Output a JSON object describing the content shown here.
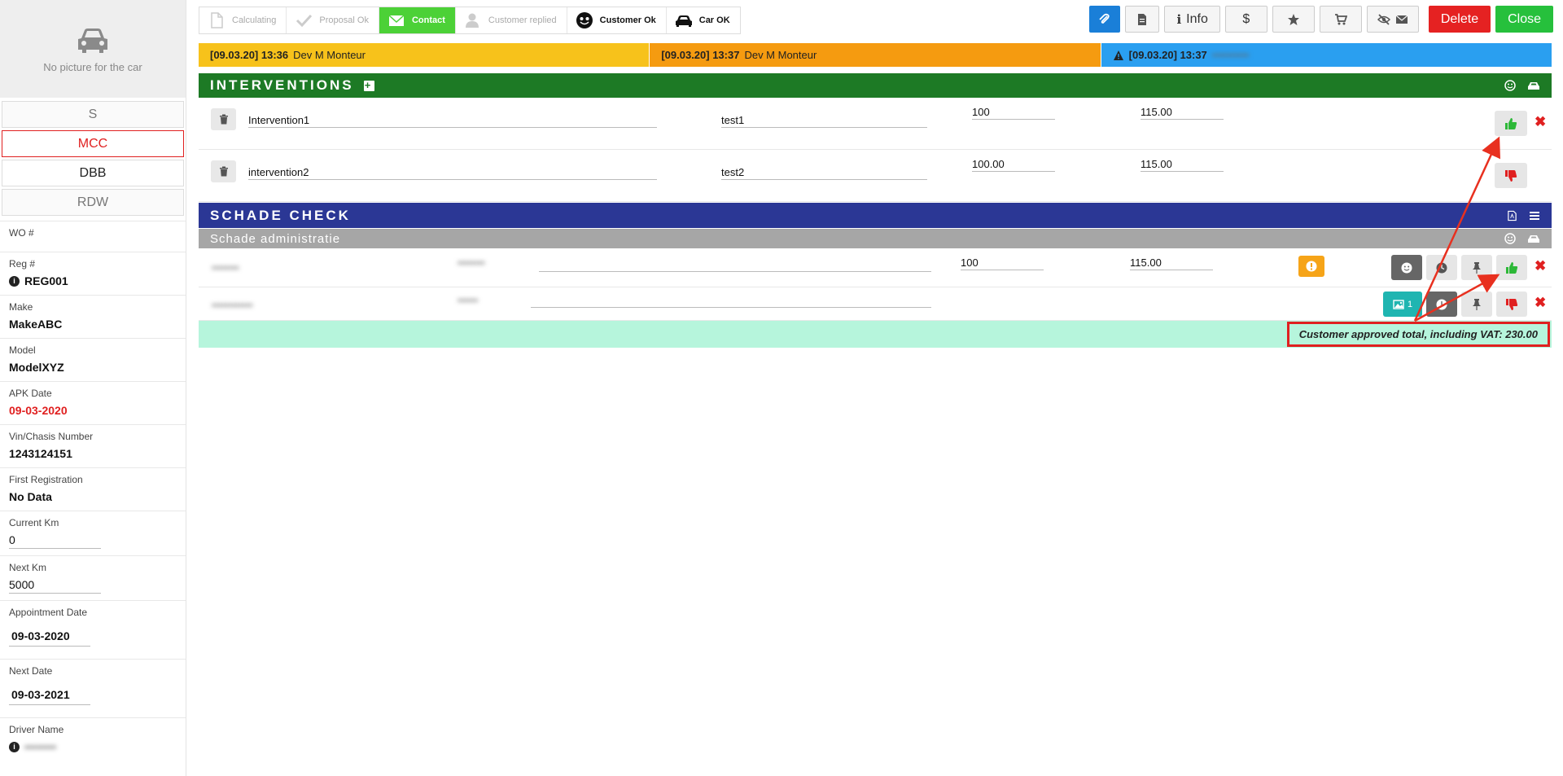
{
  "sidebar": {
    "no_picture": "No picture for the car",
    "tabs": [
      "S",
      "MCC",
      "DBB",
      "RDW"
    ],
    "fields": {
      "wo": {
        "label": "WO #",
        "value": ""
      },
      "reg": {
        "label": "Reg #",
        "value": "REG001"
      },
      "make": {
        "label": "Make",
        "value": "MakeABC"
      },
      "model": {
        "label": "Model",
        "value": "ModelXYZ"
      },
      "apk": {
        "label": "APK Date",
        "value": "09-03-2020"
      },
      "vin": {
        "label": "Vin/Chasis Number",
        "value": "1243124151"
      },
      "first_reg": {
        "label": "First Registration",
        "value": "No Data"
      },
      "current_km": {
        "label": "Current Km",
        "value": "0"
      },
      "next_km": {
        "label": "Next Km",
        "value": "5000"
      },
      "appointment": {
        "label": "Appointment Date",
        "value": "09-03-2020"
      },
      "next_date": {
        "label": "Next Date",
        "value": "09-03-2021"
      },
      "driver": {
        "label": "Driver Name",
        "value": "••••••••"
      }
    }
  },
  "steps": [
    {
      "label": "Calculating",
      "icon": "file-icon",
      "state": "pending"
    },
    {
      "label": "Proposal Ok",
      "icon": "check-icon",
      "state": "pending"
    },
    {
      "label": "Contact",
      "icon": "envelope-icon",
      "state": "active"
    },
    {
      "label": "Customer replied",
      "icon": "user-icon",
      "state": "pending"
    },
    {
      "label": "Customer Ok",
      "icon": "smile-icon",
      "state": "done"
    },
    {
      "label": "Car OK",
      "icon": "car-icon",
      "state": "done"
    }
  ],
  "actions": {
    "attach": "paperclip-icon",
    "doc": "document-icon",
    "info": "Info",
    "price": "$",
    "star": "star-icon",
    "cart": "cart-icon",
    "visibility": "eye-slash-icon",
    "delete": "Delete",
    "close": "Close"
  },
  "logs": [
    {
      "time": "[09.03.20] 13:36",
      "user": "Dev M Monteur",
      "color": "#f7c21b"
    },
    {
      "time": "[09.03.20] 13:37",
      "user": "Dev M Monteur",
      "color": "#f59b10"
    },
    {
      "time": "[09.03.20] 13:37",
      "user": "••••••••••",
      "color": "#2a9ff0"
    }
  ],
  "interventions": {
    "title": "INTERVENTIONS",
    "rows": [
      {
        "name": "Intervention1",
        "desc": "test1",
        "price": "100",
        "total": "115.00",
        "status": "approved"
      },
      {
        "name": "intervention2",
        "desc": "test2",
        "price": "100.00",
        "total": "115.00",
        "status": "rejected"
      }
    ]
  },
  "schade_check": {
    "title": "SCHADE CHECK",
    "subtitle": "Schade administratie",
    "rows": [
      {
        "name": "••••••••",
        "desc": "••••••••",
        "price": "100",
        "total": "115.00",
        "status": "approved"
      },
      {
        "name": "••••••••••••",
        "desc": "••••••",
        "price": "",
        "total": "",
        "status": "rejected",
        "photo_count": "1"
      }
    ]
  },
  "total": {
    "label": "Customer approved total, including VAT: 230.00"
  },
  "colors": {
    "interventions": "#1d7a25",
    "schade": "#2b3795",
    "approve": "#2db838",
    "reject": "#e02020",
    "total_bg": "#b6f5dc"
  }
}
